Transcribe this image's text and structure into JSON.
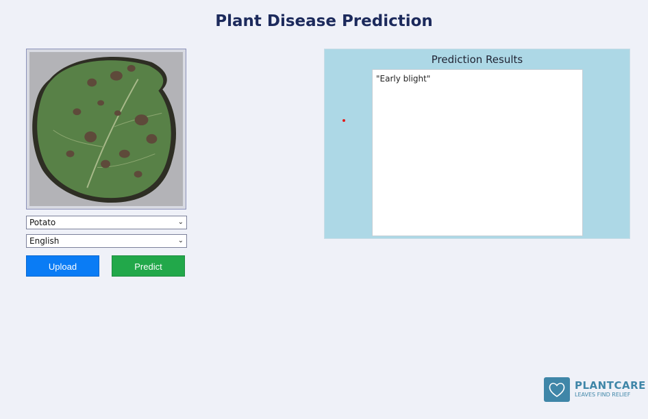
{
  "header": {
    "title": "Plant Disease Prediction"
  },
  "controls": {
    "plant_select": {
      "value": "Potato"
    },
    "language_select": {
      "value": "English"
    },
    "upload_label": "Upload",
    "predict_label": "Predict"
  },
  "results": {
    "title": "Prediction Results",
    "text": "\"Early blight\""
  },
  "logo": {
    "name": "PLANTCARE",
    "tagline": "LEAVES FIND RELIEF"
  },
  "colors": {
    "background": "#eff1f8",
    "title": "#1c2a5c",
    "upload": "#0a7cf5",
    "predict": "#22a84a",
    "results_panel": "#add8e6",
    "logo": "#3f86a8"
  }
}
